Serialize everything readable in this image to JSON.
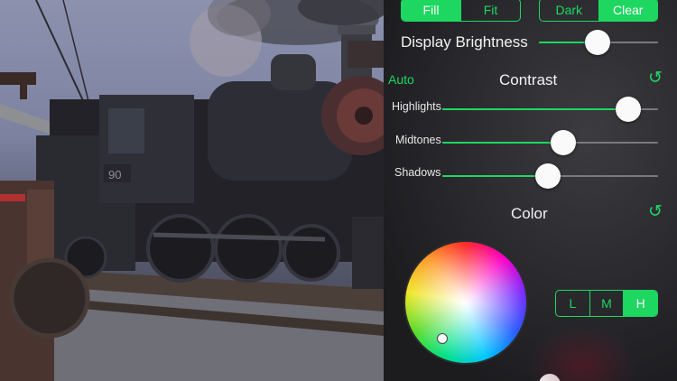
{
  "photo": {
    "engine_number": "90"
  },
  "layout_segment": {
    "options": [
      "Fill",
      "Fit"
    ],
    "selected": "Fill"
  },
  "theme_segment": {
    "options": [
      "Dark",
      "Clear"
    ],
    "selected": "Clear"
  },
  "display_brightness": {
    "label": "Display Brightness",
    "value": 0.49
  },
  "contrast": {
    "auto_label": "Auto",
    "title": "Contrast",
    "reset_icon": "reset-icon",
    "highlights": {
      "label": "Highlights",
      "value": 0.86
    },
    "midtones": {
      "label": "Midtones",
      "value": 0.56
    },
    "shadows": {
      "label": "Shadows",
      "value": 0.49
    }
  },
  "color": {
    "title": "Color",
    "reset_icon": "reset-icon",
    "range_segment": {
      "options": [
        "L",
        "M",
        "H"
      ],
      "selected": "H"
    }
  },
  "colors": {
    "accent": "#1ed760",
    "panel": "#2a2a2e"
  }
}
